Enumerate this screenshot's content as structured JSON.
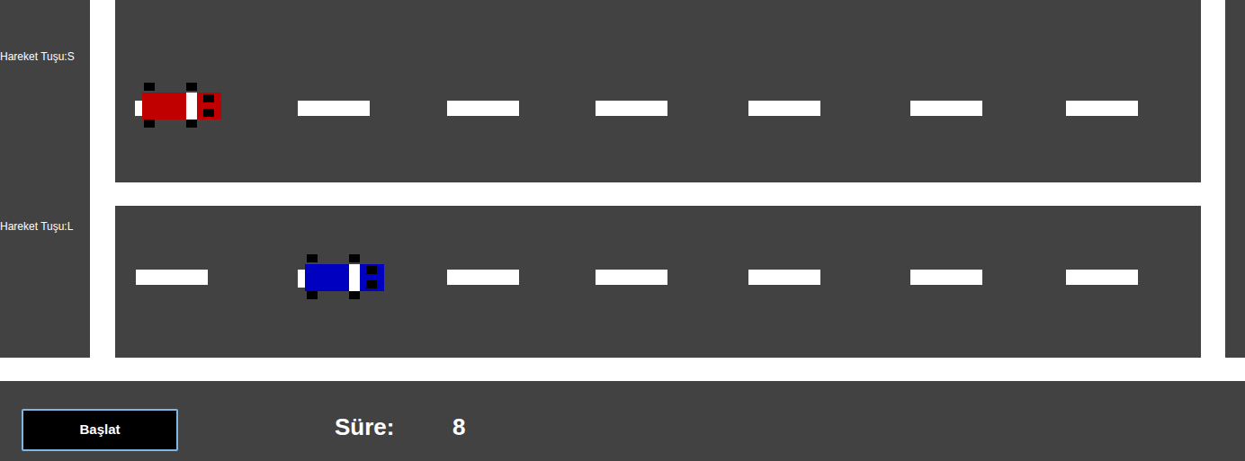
{
  "lanes": [
    {
      "label": "Hareket Tuşu:S",
      "car": {
        "color": "#c00000",
        "level": 0.02
      }
    },
    {
      "label": "Hareket Tuşu:L",
      "car": {
        "color": "#0000c0",
        "level": 0.183
      }
    }
  ],
  "start_button": {
    "label": "Başlat"
  },
  "timer": {
    "label": "Süre:",
    "value": "8"
  }
}
